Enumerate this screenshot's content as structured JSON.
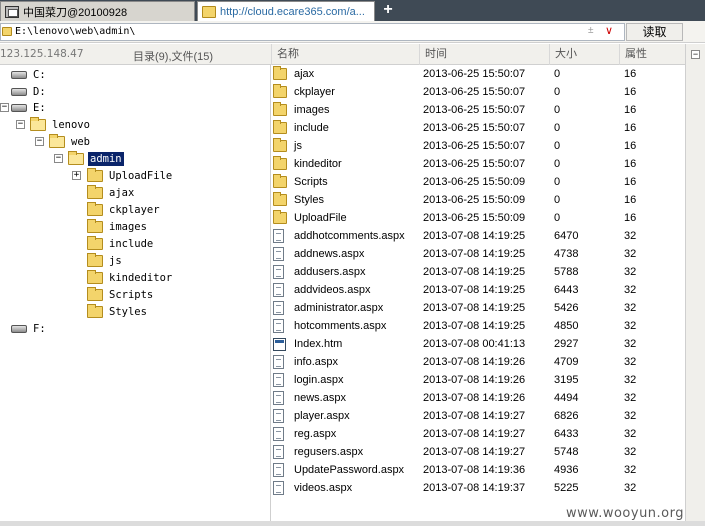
{
  "tabs": [
    {
      "label": "中国菜刀@20100928",
      "icon": "window-icon"
    },
    {
      "label": "http://cloud.ecare365.com/a...",
      "icon": "folder-icon"
    }
  ],
  "newtab_label": "+",
  "address": {
    "path": "E:\\lenovo\\web\\admin\\",
    "history_glyph": "±",
    "dropdown_glyph": "∨",
    "read_button": "读取"
  },
  "header": {
    "ip": "123.125.148.47",
    "count": "目录(9),文件(15)",
    "columns": {
      "name": "名称",
      "time": "时间",
      "size": "大小",
      "attr": "属性"
    }
  },
  "tree": {
    "c": "C:",
    "d": "D:",
    "e": "E:",
    "f": "F:",
    "lenovo": "lenovo",
    "web": "web",
    "admin": "admin",
    "children": [
      "UploadFile",
      "ajax",
      "ckplayer",
      "images",
      "include",
      "js",
      "kindeditor",
      "Scripts",
      "Styles"
    ]
  },
  "files": [
    {
      "name": "ajax",
      "time": "2013-06-25 15:50:07",
      "size": "0",
      "attr": "16",
      "type": "dir"
    },
    {
      "name": "ckplayer",
      "time": "2013-06-25 15:50:07",
      "size": "0",
      "attr": "16",
      "type": "dir"
    },
    {
      "name": "images",
      "time": "2013-06-25 15:50:07",
      "size": "0",
      "attr": "16",
      "type": "dir"
    },
    {
      "name": "include",
      "time": "2013-06-25 15:50:07",
      "size": "0",
      "attr": "16",
      "type": "dir"
    },
    {
      "name": "js",
      "time": "2013-06-25 15:50:07",
      "size": "0",
      "attr": "16",
      "type": "dir"
    },
    {
      "name": "kindeditor",
      "time": "2013-06-25 15:50:07",
      "size": "0",
      "attr": "16",
      "type": "dir"
    },
    {
      "name": "Scripts",
      "time": "2013-06-25 15:50:09",
      "size": "0",
      "attr": "16",
      "type": "dir"
    },
    {
      "name": "Styles",
      "time": "2013-06-25 15:50:09",
      "size": "0",
      "attr": "16",
      "type": "dir"
    },
    {
      "name": "UploadFile",
      "time": "2013-06-25 15:50:09",
      "size": "0",
      "attr": "16",
      "type": "dir"
    },
    {
      "name": "addhotcomments.aspx",
      "time": "2013-07-08 14:19:25",
      "size": "6470",
      "attr": "32",
      "type": "doc"
    },
    {
      "name": "addnews.aspx",
      "time": "2013-07-08 14:19:25",
      "size": "4738",
      "attr": "32",
      "type": "doc"
    },
    {
      "name": "addusers.aspx",
      "time": "2013-07-08 14:19:25",
      "size": "5788",
      "attr": "32",
      "type": "doc"
    },
    {
      "name": "addvideos.aspx",
      "time": "2013-07-08 14:19:25",
      "size": "6443",
      "attr": "32",
      "type": "doc"
    },
    {
      "name": "administrator.aspx",
      "time": "2013-07-08 14:19:25",
      "size": "5426",
      "attr": "32",
      "type": "doc"
    },
    {
      "name": "hotcomments.aspx",
      "time": "2013-07-08 14:19:25",
      "size": "4850",
      "attr": "32",
      "type": "doc"
    },
    {
      "name": "Index.htm",
      "time": "2013-07-08 00:41:13",
      "size": "2927",
      "attr": "32",
      "type": "htm"
    },
    {
      "name": "info.aspx",
      "time": "2013-07-08 14:19:26",
      "size": "4709",
      "attr": "32",
      "type": "doc"
    },
    {
      "name": "login.aspx",
      "time": "2013-07-08 14:19:26",
      "size": "3195",
      "attr": "32",
      "type": "doc"
    },
    {
      "name": "news.aspx",
      "time": "2013-07-08 14:19:26",
      "size": "4494",
      "attr": "32",
      "type": "doc"
    },
    {
      "name": "player.aspx",
      "time": "2013-07-08 14:19:27",
      "size": "6826",
      "attr": "32",
      "type": "doc"
    },
    {
      "name": "reg.aspx",
      "time": "2013-07-08 14:19:27",
      "size": "6433",
      "attr": "32",
      "type": "doc"
    },
    {
      "name": "regusers.aspx",
      "time": "2013-07-08 14:19:27",
      "size": "5748",
      "attr": "32",
      "type": "doc"
    },
    {
      "name": "UpdatePassword.aspx",
      "time": "2013-07-08 14:19:36",
      "size": "4936",
      "attr": "32",
      "type": "doc"
    },
    {
      "name": "videos.aspx",
      "time": "2013-07-08 14:19:37",
      "size": "5225",
      "attr": "32",
      "type": "doc"
    }
  ],
  "watermark": "www.wooyun.org",
  "colors": {
    "selection": "#0a246a",
    "folder": "#f3d46b",
    "tab_link": "#2a6aa3"
  }
}
